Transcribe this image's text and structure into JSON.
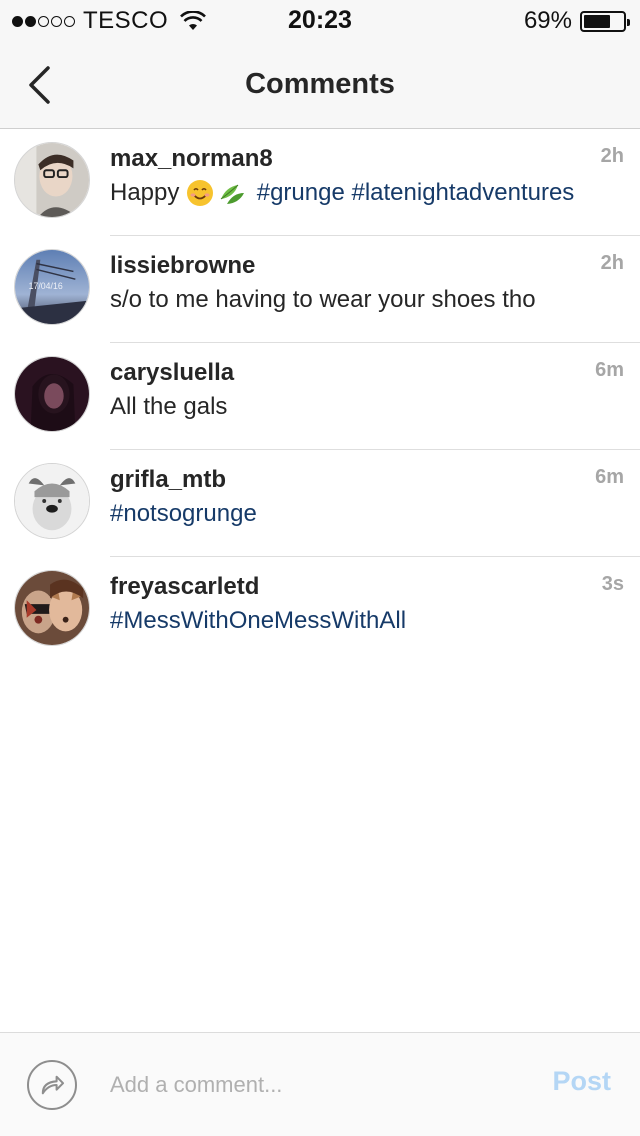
{
  "status_bar": {
    "carrier": "TESCO",
    "signal_bars": 2,
    "time": "20:23",
    "battery_percent": "69%",
    "battery_level": 0.69
  },
  "nav": {
    "title": "Comments",
    "back_icon": "chevron-left-icon"
  },
  "comments": [
    {
      "username": "max_norman8",
      "text": "Happy",
      "emojis": [
        "smiling-face-icon",
        "leaves-icon"
      ],
      "hashtags": "#grunge #latenightadventures",
      "time": "2h"
    },
    {
      "username": "lissiebrowne",
      "text": "s/o to me having to wear your shoes tho",
      "avatar_text": "17/04/16",
      "time": "2h"
    },
    {
      "username": "carysluella",
      "text": "All the gals",
      "time": "6m"
    },
    {
      "username": "grifla_mtb",
      "hashtags": "#notsogrunge",
      "time": "6m"
    },
    {
      "username": "freyascarletd",
      "hashtags": "#MessWithOneMessWithAll",
      "time": "3s"
    }
  ],
  "input_bar": {
    "share_icon": "share-arrow-icon",
    "placeholder": "Add a comment...",
    "value": "",
    "post_label": "Post"
  },
  "colors": {
    "hashtag": "#163a68",
    "post_disabled": "#b4d6f5",
    "timestamp": "#a6a6a6"
  }
}
